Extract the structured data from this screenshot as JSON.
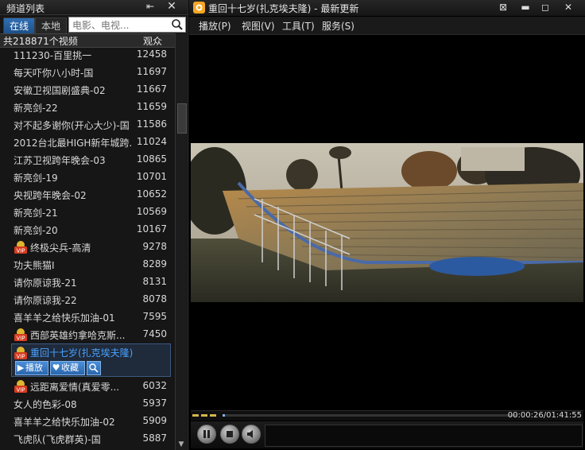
{
  "left_panel": {
    "title": "频道列表",
    "pin_icon": "pin-icon",
    "close_icon": "close-icon",
    "tabs": {
      "online": "在线",
      "local": "本地"
    },
    "search": {
      "placeholder": "电影、电视..."
    },
    "header": {
      "count_label": "共218871个视频",
      "views_label": "观众"
    },
    "items": [
      {
        "name": "111230-百里挑一",
        "count": "12458",
        "vip": false
      },
      {
        "name": "每天吓你八小时-国",
        "count": "11697",
        "vip": false
      },
      {
        "name": "安徽卫视国剧盛典-02",
        "count": "11667",
        "vip": false
      },
      {
        "name": "新亮剑-22",
        "count": "11659",
        "vip": false
      },
      {
        "name": "对不起多谢你(开心大少)-国",
        "count": "11586",
        "vip": false
      },
      {
        "name": "2012台北最HIGH新年城跨...",
        "count": "11024",
        "vip": false
      },
      {
        "name": "江苏卫视跨年晚会-03",
        "count": "10865",
        "vip": false
      },
      {
        "name": "新亮剑-19",
        "count": "10701",
        "vip": false
      },
      {
        "name": "央视跨年晚会-02",
        "count": "10652",
        "vip": false
      },
      {
        "name": "新亮剑-21",
        "count": "10569",
        "vip": false
      },
      {
        "name": "新亮剑-20",
        "count": "10167",
        "vip": false
      },
      {
        "name": "终极尖兵-高清",
        "count": "9278",
        "vip": true
      },
      {
        "name": "功夫熊猫I",
        "count": "8289",
        "vip": false
      },
      {
        "name": "请你原谅我-21",
        "count": "8131",
        "vip": false
      },
      {
        "name": "请你原谅我-22",
        "count": "8078",
        "vip": false
      },
      {
        "name": "喜羊羊之给快乐加油-01",
        "count": "7595",
        "vip": false
      },
      {
        "name": "西部英雄约拿哈克斯...",
        "count": "7450",
        "vip": true
      }
    ],
    "selected": {
      "name": "重回十七岁(扎克埃夫隆)",
      "vip": true,
      "play_label": "播放",
      "fav_label": "收藏"
    },
    "items_after": [
      {
        "name": "远距离爱情(真爱零...",
        "count": "6032",
        "vip": true
      },
      {
        "name": "女人的色彩-08",
        "count": "5937",
        "vip": false
      },
      {
        "name": "喜羊羊之给快乐加油-02",
        "count": "5909",
        "vip": false
      },
      {
        "name": "飞虎队(飞虎群英)-国",
        "count": "5887",
        "vip": false
      }
    ]
  },
  "player": {
    "title": "重回十七岁(扎克埃夫隆) - 最新更新",
    "menu": [
      "播放(P)",
      "视图(V)",
      "工具(T)",
      "服务(S)"
    ],
    "time": "00:00:26/01:41:55",
    "progress_fraction": 0.004
  },
  "colors": {
    "accent": "#2f6fb3",
    "selected_text": "#4aa3ff",
    "vip": "#d63b1f"
  }
}
